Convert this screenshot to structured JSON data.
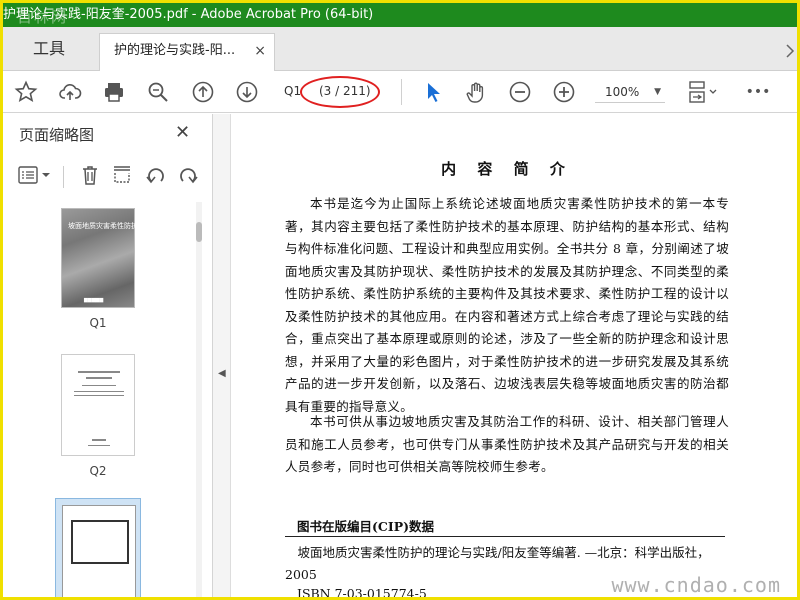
{
  "window": {
    "title": "护理论与实践-阳友奎-2005.pdf - Adobe Acrobat Pro (64-bit)",
    "watermark_top": "百林网"
  },
  "tabs": {
    "tools_label": "工具",
    "doc_tab_label": "护的理论与实践-阳...",
    "close_glyph": "×"
  },
  "toolbar": {
    "page_input_value": "Q1",
    "page_count": "(3 / 211)",
    "zoom_value": "100%",
    "more_glyph": "•••"
  },
  "sidebar": {
    "title": "页面缩略图",
    "close_glyph": "✕",
    "thumbnails": [
      {
        "label": "Q1",
        "cover_text": "坡面地质灾害柔性防护"
      },
      {
        "label": "Q2"
      },
      {
        "label": ""
      }
    ]
  },
  "document": {
    "heading": "内 容 简 介",
    "paragraphs": [
      "本书是迄今为止国际上系统论述坡面地质灾害柔性防护技术的第一本专著，其内容主要包括了柔性防护技术的基本原理、防护结构的基本形式、结构与构件标准化问题、工程设计和典型应用实例。全书共分 8 章，分别阐述了坡面地质灾害及其防护现状、柔性防护技术的发展及其防护理念、不同类型的柔性防护系统、柔性防护系统的主要构件及其技术要求、柔性防护工程的设计以及柔性防护技术的其他应用。在内容和著述方式上综合考虑了理论与实践的结合，重点突出了基本原理或原则的论述，涉及了一些全新的防护理念和设计思想，并采用了大量的彩色图片，对于柔性防护技术的进一步研究发展及其系统产品的进一步开发创新，以及落石、边坡浅表层失稳等坡面地质灾害的防治都具有重要的指导意义。",
      "本书可供从事边坡地质灾害及其防治工作的科研、设计、相关部门管理人员和施工人员参考，也可供专门从事柔性防护技术及其产品研究与开发的相关人员参考，同时也可供相关高等院校师生参考。"
    ],
    "cip_title": "图书在版编目(CIP)数据",
    "cip_body": "坡面地质灾害柔性防护的理论与实践/阳友奎等编著. —北京：科学出版社，2005",
    "isbn": "ISBN 7-03-015774-5"
  },
  "watermark": "www.cndao.com",
  "colors": {
    "titlebar": "#1e8a1e",
    "frame": "#f0e000",
    "highlight_ellipse": "#e02020",
    "select_tool": "#1a6fd6"
  }
}
